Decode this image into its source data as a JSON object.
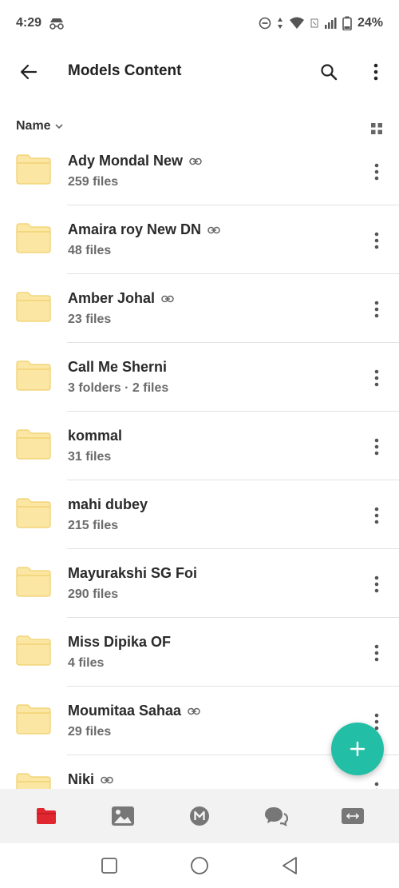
{
  "status_bar": {
    "time": "4:29",
    "battery": "24%"
  },
  "app_bar": {
    "title": "Models Content"
  },
  "sort": {
    "label": "Name"
  },
  "files": [
    {
      "name": "Ady Mondal New",
      "meta": "259 files",
      "shared": true
    },
    {
      "name": "Amaira roy New DN",
      "meta": "48 files",
      "shared": true
    },
    {
      "name": "Amber Johal",
      "meta": "23 files",
      "shared": true
    },
    {
      "name": "Call Me Sherni",
      "meta": "3 folders · 2 files",
      "shared": false
    },
    {
      "name": "kommal",
      "meta": "31 files",
      "shared": false
    },
    {
      "name": "mahi dubey",
      "meta": "215 files",
      "shared": false
    },
    {
      "name": "Mayurakshi SG Foi",
      "meta": "290 files",
      "shared": false
    },
    {
      "name": "Miss Dipika OF",
      "meta": "4 files",
      "shared": false
    },
    {
      "name": "Moumitaa Sahaa",
      "meta": "29 files",
      "shared": true
    },
    {
      "name": "Niki",
      "meta": "",
      "shared": true
    }
  ],
  "bottom_nav": [
    {
      "icon": "folder-icon",
      "active": true
    },
    {
      "icon": "photos-icon",
      "active": false
    },
    {
      "icon": "meetings-icon",
      "active": false
    },
    {
      "icon": "chat-icon",
      "active": false
    },
    {
      "icon": "transfers-icon",
      "active": false
    }
  ],
  "colors": {
    "accent": "#22bfa6",
    "active_nav": "#e0262f",
    "folder_fill": "#fbe6a3",
    "folder_stroke": "#f0cf6c"
  }
}
